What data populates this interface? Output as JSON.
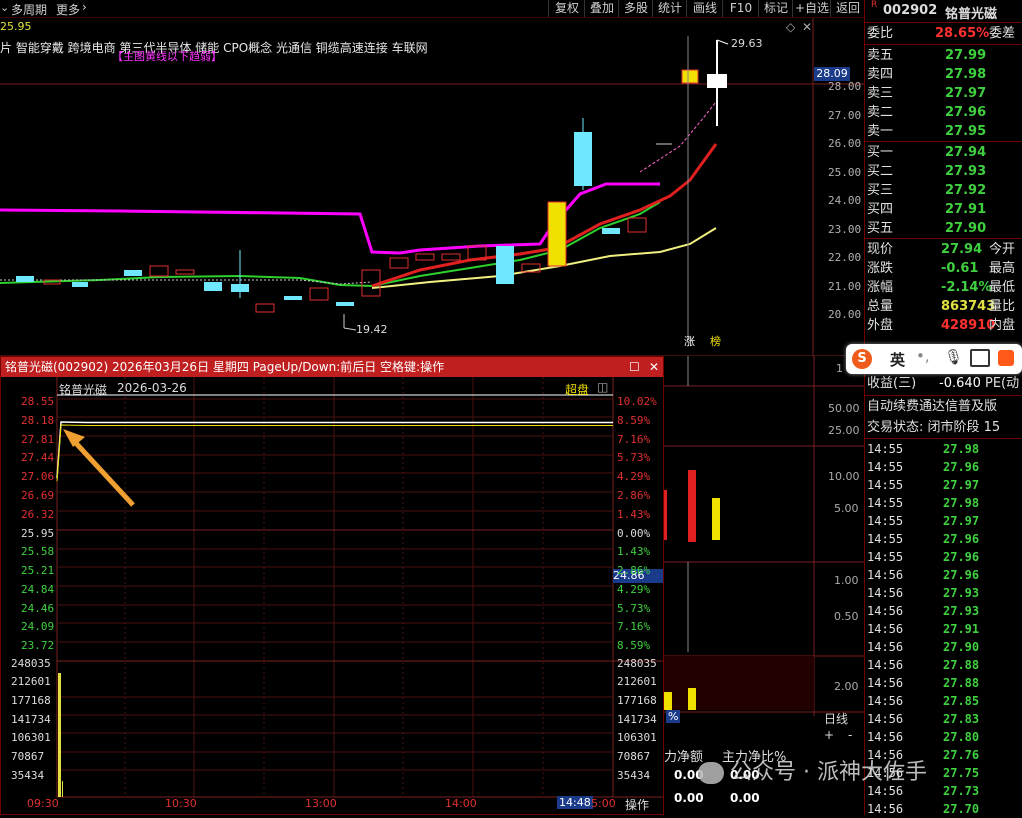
{
  "topbar": {
    "left_items": [
      "多周期",
      "更多"
    ],
    "right_items": [
      "复权",
      "叠加",
      "多股",
      "统计",
      "画线",
      "F10",
      "标记",
      "+自选",
      "返回"
    ]
  },
  "main_chart": {
    "top_price": "25.95",
    "concepts": "片 智能穿戴 跨境电商 第三代半导体 储能 CPO概念 光通信 铜缆高速连接 车联网",
    "trend_tag": "【主图黄线以下趋弱】",
    "high_label": "29.63",
    "low_label": "19.42",
    "current_price_marker": "28.09",
    "y_axis": [
      "28.00",
      "27.00",
      "26.00",
      "25.00",
      "24.00",
      "23.00",
      "22.00",
      "21.00",
      "20.00"
    ],
    "markers": [
      "涨",
      "榜"
    ]
  },
  "chart_data": {
    "type": "line",
    "title": "铭普光磁 2026-03-26",
    "x": [
      "09:30",
      "10:30",
      "13:00",
      "14:00",
      "15:00"
    ],
    "series": [
      {
        "name": "铭普光磁",
        "values": [
          27.0,
          28.1,
          28.09,
          28.09,
          28.09
        ]
      }
    ],
    "xlabel": "",
    "ylabel": "",
    "ylim": [
      23.72,
      28.55
    ]
  },
  "popup": {
    "title": "铭普光磁(002902) 2026年03月26日 星期四 PageUp/Down:前后日 空格键:操作",
    "sub_name": "铭普光磁",
    "sub_date": "2026-03-26",
    "overlay_btn": "超盘",
    "left_axis": [
      "28.55",
      "28.18",
      "27.81",
      "27.44",
      "27.06",
      "26.69",
      "26.32",
      "25.95",
      "25.58",
      "25.21",
      "24.84",
      "24.46",
      "24.09",
      "23.72"
    ],
    "right_axis": [
      "10.02%",
      "8.59%",
      "7.16%",
      "5.73%",
      "4.29%",
      "2.86%",
      "1.43%",
      "0.00%",
      "1.43%",
      "2.86%",
      "4.29%",
      "5.73%",
      "7.16%",
      "8.59%"
    ],
    "vol_axis": [
      "248035",
      "212601",
      "177168",
      "141734",
      "106301",
      "70867",
      "35434"
    ],
    "time_axis": [
      "09:30",
      "10:30",
      "13:00",
      "14:00"
    ],
    "time_end_cursor": "14:48",
    "time_end": "5:00",
    "op_btn": "操作",
    "price_cursor": "24.86"
  },
  "middle": {
    "axis_1": "1",
    "axis_a": [
      "50.00",
      "25.00"
    ],
    "axis_b": [
      "10.00",
      "5.00"
    ],
    "axis_c": [
      "1.00",
      "0.50"
    ],
    "axis_d": "2.00",
    "day_line": "日线",
    "pct": "%",
    "net_label_1": "力净额",
    "net_label_2": "主力净比%",
    "net_v1": "0.00",
    "net_v2": "0.00",
    "net_v3": "0.00",
    "net_v4": "0.00"
  },
  "right_panel": {
    "code": "002902",
    "name": "铭普光磁",
    "ratio_label": "委比",
    "ratio_value": "28.65%",
    "ratio_suffix": "委差",
    "asks": [
      {
        "label": "卖五",
        "price": "27.99"
      },
      {
        "label": "卖四",
        "price": "27.98"
      },
      {
        "label": "卖三",
        "price": "27.97"
      },
      {
        "label": "卖二",
        "price": "27.96"
      },
      {
        "label": "卖一",
        "price": "27.95"
      }
    ],
    "bids": [
      {
        "label": "买一",
        "price": "27.94"
      },
      {
        "label": "买二",
        "price": "27.93"
      },
      {
        "label": "买三",
        "price": "27.92"
      },
      {
        "label": "买四",
        "price": "27.91"
      },
      {
        "label": "买五",
        "price": "27.90"
      }
    ],
    "quote": [
      {
        "label": "现价",
        "value": "27.94",
        "suffix": "今开"
      },
      {
        "label": "涨跌",
        "value": "-0.61",
        "suffix": "最高"
      },
      {
        "label": "涨幅",
        "value": "-2.14%",
        "suffix": "最低"
      },
      {
        "label": "总量",
        "value": "863743",
        "suffix": "量比"
      },
      {
        "label": "外盘",
        "value": "428910",
        "suffix": "内盘"
      }
    ],
    "income_label": "收益(三)",
    "income_value": "-0.640",
    "income_suffix": "PE(动",
    "notice": "自动续费通达信普及版",
    "status": "交易状态: 闭市阶段 15",
    "ticks": [
      {
        "t": "14:55",
        "p": "27.98"
      },
      {
        "t": "14:55",
        "p": "27.96"
      },
      {
        "t": "14:55",
        "p": "27.97"
      },
      {
        "t": "14:55",
        "p": "27.98"
      },
      {
        "t": "14:55",
        "p": "27.97"
      },
      {
        "t": "14:55",
        "p": "27.96"
      },
      {
        "t": "14:55",
        "p": "27.96"
      },
      {
        "t": "14:56",
        "p": "27.96"
      },
      {
        "t": "14:56",
        "p": "27.93"
      },
      {
        "t": "14:56",
        "p": "27.93"
      },
      {
        "t": "14:56",
        "p": "27.91"
      },
      {
        "t": "14:56",
        "p": "27.90"
      },
      {
        "t": "14:56",
        "p": "27.88"
      },
      {
        "t": "14:56",
        "p": "27.88"
      },
      {
        "t": "14:56",
        "p": "27.85"
      },
      {
        "t": "14:56",
        "p": "27.83"
      },
      {
        "t": "14:56",
        "p": "27.80"
      },
      {
        "t": "14:56",
        "p": "27.76"
      },
      {
        "t": "14:56",
        "p": "27.75"
      },
      {
        "t": "14:56",
        "p": "27.73"
      },
      {
        "t": "14:56",
        "p": "27.70"
      }
    ]
  },
  "ime": {
    "label": "英"
  },
  "watermark": "公众号 · 派神大佐手"
}
